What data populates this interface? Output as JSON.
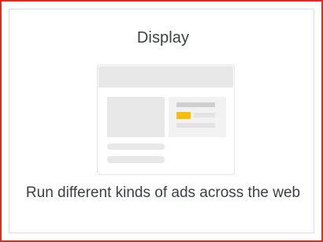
{
  "card": {
    "title": "Display",
    "description": "Run different kinds of ads across the web",
    "illustration_icon": "display-ad-layout-icon",
    "colors": {
      "selected_border": "#d93025",
      "accent": "#fbbc04",
      "text": "#3c4043"
    }
  }
}
